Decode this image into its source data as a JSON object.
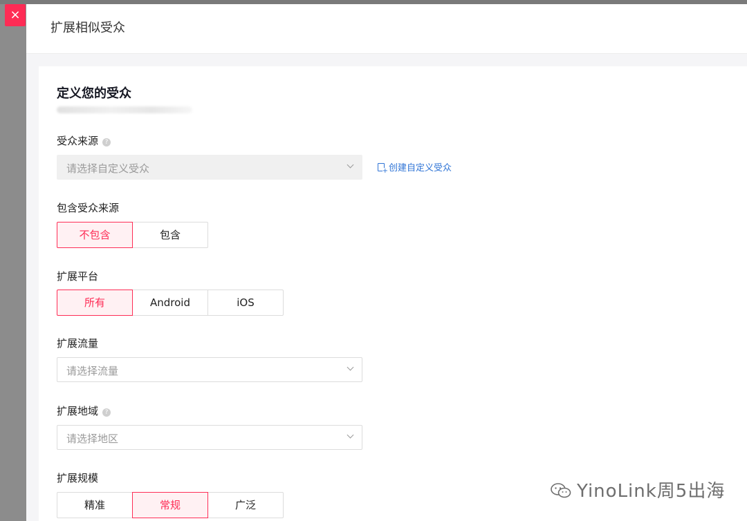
{
  "drawer": {
    "title": "扩展相似受众",
    "close_icon": "×"
  },
  "card": {
    "section_title": "定义您的受众"
  },
  "audience_source": {
    "label": "受众来源",
    "help_icon": "?",
    "placeholder": "请选择自定义受众",
    "create_link": "创建自定义受众"
  },
  "include_source": {
    "label": "包含受众来源",
    "options": [
      "不包含",
      "包含"
    ],
    "selected": "不包含"
  },
  "platform": {
    "label": "扩展平台",
    "options": [
      "所有",
      "Android",
      "iOS"
    ],
    "selected": "所有"
  },
  "traffic": {
    "label": "扩展流量",
    "placeholder": "请选择流量"
  },
  "region": {
    "label": "扩展地域",
    "help_icon": "?",
    "placeholder": "请选择地区"
  },
  "scale": {
    "label": "扩展规模",
    "options": [
      "精准",
      "常规",
      "广泛"
    ],
    "selected": "常规"
  },
  "watermark": {
    "text": "YinoLink周5出海"
  },
  "colors": {
    "accent": "#fe2c55",
    "accent_bg": "#fff1f3",
    "link": "#2f74d6"
  }
}
